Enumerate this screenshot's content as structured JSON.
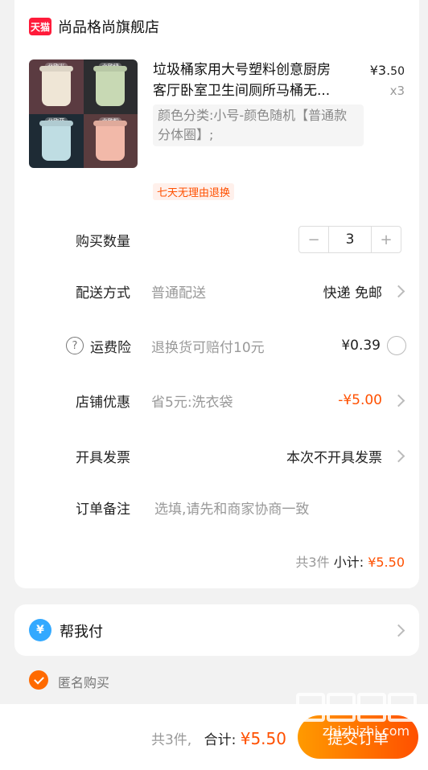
{
  "shop": {
    "badge": "天猫",
    "name": "尚品格尚旗舰店"
  },
  "product": {
    "title_line1": "垃圾桶家用大号塑料创意厨房",
    "title_line2": "客厅卧室卫生间厕所马桶无...",
    "price_symbol": "¥",
    "price_int": "3.",
    "price_dec": "50",
    "qty": "x3",
    "sku": "颜色分类:小号-颜色随机【普通款分体圈】;",
    "return_badge": "七天无理由退换",
    "image_tags": [
      "北欧米",
      "北欧绿",
      "北欧蓝",
      "北欧粉"
    ]
  },
  "rows": {
    "quantity": {
      "label": "购买数量",
      "value": "3",
      "minus": "−",
      "plus": "+"
    },
    "delivery": {
      "label": "配送方式",
      "sub": "普通配送",
      "right": "快递 免邮"
    },
    "insurance": {
      "label": "运费险",
      "sub": "退换货可赔付10元",
      "right": "¥0.39",
      "icon": "?"
    },
    "discount": {
      "label": "店铺优惠",
      "sub": "省5元:洗衣袋",
      "right": "-¥5.00"
    },
    "invoice": {
      "label": "开具发票",
      "right": "本次不开具发票"
    },
    "note": {
      "label": "订单备注",
      "placeholder": "选填,请先和商家协商一致"
    }
  },
  "subtotal": {
    "count": "共3件",
    "label": "小计:",
    "amount": "¥5.50"
  },
  "help_pay": {
    "label": "帮我付",
    "icon": "¥"
  },
  "anonymous": {
    "label": "匿名购买"
  },
  "bottom": {
    "count": "共3件,",
    "label": "合计:",
    "amount": "¥5.50",
    "submit": "提交订单"
  },
  "watermark": {
    "text": "zhizhizhi.com"
  },
  "colors": {
    "accent": "#ff5000",
    "tmall_red": "#ff1b3a",
    "help_blue": "#33a9ff"
  }
}
